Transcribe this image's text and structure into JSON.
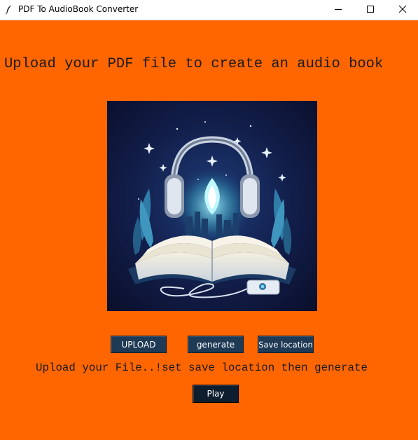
{
  "window": {
    "title": "PDF To AudioBook Converter",
    "background": "#ff6600"
  },
  "main": {
    "heading": "Upload your PDF file to create an audio book",
    "cover_image": "book-headphones-illustration",
    "buttons": {
      "upload": "UPLOAD",
      "generate": "generate",
      "save_location": "Save location",
      "play": "Play"
    },
    "status": "Upload your File..!set save location then generate"
  },
  "icons": {
    "app": "feather-icon",
    "minimize": "minimize-icon",
    "maximize": "maximize-icon",
    "close": "close-icon"
  }
}
